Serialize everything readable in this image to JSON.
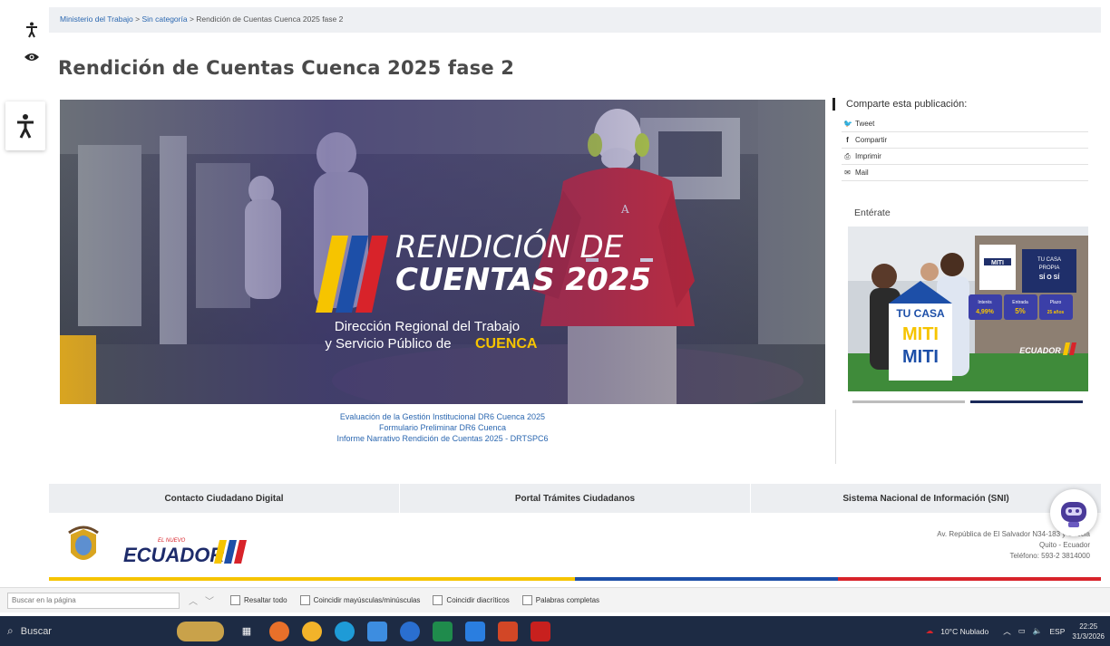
{
  "breadcrumb": {
    "home": "Ministerio del Trabajo",
    "sep1": " > ",
    "category": "Sin categoría",
    "sep2": " > ",
    "current": "Rendición de Cuentas Cuenca 2025 fase 2"
  },
  "page_title": "Rendición de Cuentas Cuenca 2025 fase 2",
  "hero": {
    "headline1": "RENDICIÓN DE",
    "headline2": "CUENTAS 2025",
    "sub1": "Dirección Regional del Trabajo",
    "sub2": "y Servicio Público de",
    "sub_city": "CUENCA",
    "shirt_mark": "A"
  },
  "document_links": [
    "Evaluación de la Gestión Institucional DR6 Cuenca 2025",
    "Formulario Preliminar DR6 Cuenca",
    "Informe Narrativo Rendición de Cuentas 2025 - DRTSPC6"
  ],
  "share": {
    "title": "Comparte esta publicación:",
    "items": [
      {
        "icon": "twitter-icon",
        "glyph": "🐦",
        "label": "Tweet"
      },
      {
        "icon": "facebook-icon",
        "glyph": "f",
        "label": "Compartir"
      },
      {
        "icon": "print-icon",
        "glyph": "⎙",
        "label": "Imprimir"
      },
      {
        "icon": "mail-icon",
        "glyph": "✉",
        "label": "Mail"
      }
    ]
  },
  "enterate": "Entérate",
  "promo": {
    "sign_line1": "TU CASA",
    "sign_line2": "PROPIA",
    "sign_line3": "SÍ O SÍ",
    "house_line1": "TU CASA",
    "house_line2": "MITI",
    "house_line3": "MITI",
    "roof_mark": "MITI",
    "badges": [
      {
        "top": "Interés",
        "value": "4,99%"
      },
      {
        "top": "Entrada",
        "value": "5%"
      },
      {
        "top": "Plazo",
        "value": "25 años"
      }
    ]
  },
  "footer_nav": [
    "Contacto Ciudadano Digital",
    "Portal Trámites Ciudadanos",
    "Sistema Nacional de Información (SNI)"
  ],
  "footer": {
    "logo_small": "EL NUEVO",
    "logo_text": "ECUADOR",
    "address_line1": "Av. República de El Salvador N34-183 y Suecia",
    "address_line2": "Quito - Ecuador",
    "address_line3": "Teléfono: 593-2 3814000"
  },
  "colors": {
    "yellow": "#f6c400",
    "blue": "#1d4fa8",
    "red": "#d8232a",
    "link": "#2b67b0"
  },
  "findbar": {
    "placeholder": "Buscar en la página",
    "highlight_all": "Resaltar todo",
    "match_case": "Coincidir mayúsculas/minúsculas",
    "match_diacritics": "Coincidir diacríticos",
    "whole_words": "Palabras completas"
  },
  "taskbar": {
    "search_label": "Buscar",
    "weather": "10°C Nublado",
    "lang": "ESP",
    "time": "22:25",
    "date": "31/3/2026"
  }
}
